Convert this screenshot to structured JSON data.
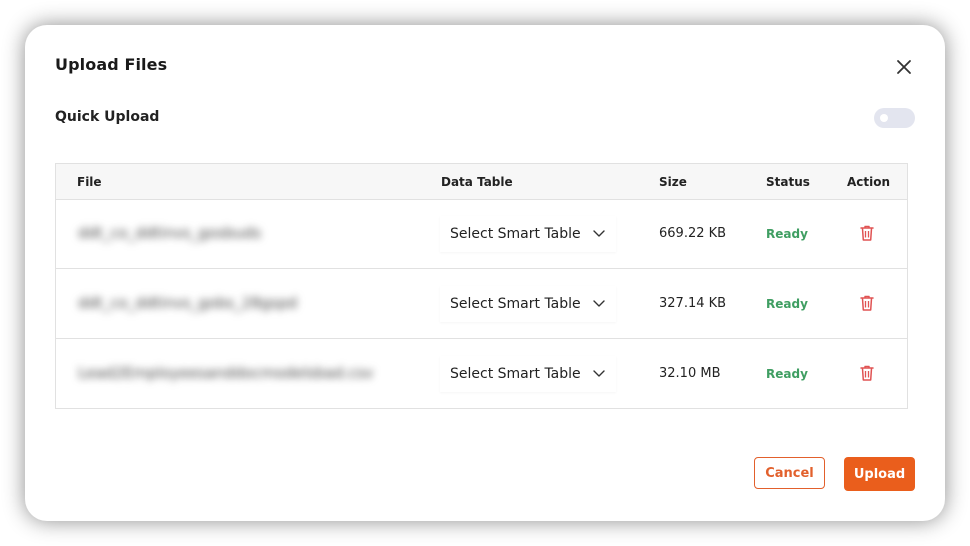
{
  "modal": {
    "title": "Upload Files",
    "quick_upload_label": "Quick Upload",
    "quick_upload_enabled": false
  },
  "table": {
    "headers": {
      "file": "File",
      "data_table": "Data Table",
      "size": "Size",
      "status": "Status",
      "action": "Action"
    },
    "rows": [
      {
        "file": "ddt_co_ddtinvs_gosbuds",
        "data_table": "Select Smart Table",
        "size": "669.22 KB",
        "status": "Ready"
      },
      {
        "file": "ddt_co_ddtinvs_gobs_28gspd",
        "data_table": "Select Smart Table",
        "size": "327.14 KB",
        "status": "Ready"
      },
      {
        "file": "Lead2Employeesanddocmodelsbad.csv",
        "data_table": "Select Smart Table",
        "size": "32.10 MB",
        "status": "Ready"
      }
    ]
  },
  "footer": {
    "cancel_label": "Cancel",
    "upload_label": "Upload"
  },
  "colors": {
    "accent": "#ea5e1c",
    "status_ready": "#3f9e62",
    "delete_icon": "#e05252"
  },
  "icons": {
    "close": "close-icon",
    "dropdown": "chevron-down-icon",
    "delete": "trash-icon"
  }
}
